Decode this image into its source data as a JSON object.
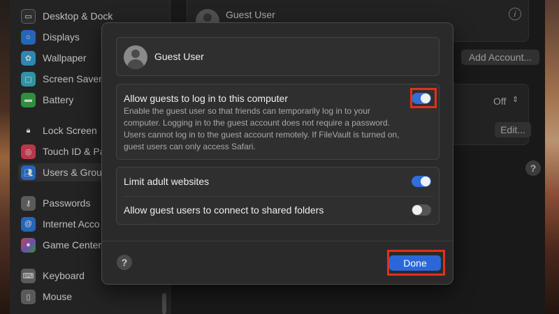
{
  "sidebar": {
    "items": [
      {
        "label": "Desktop & Dock",
        "icon": "desktop-dock-icon",
        "color": "#3a3a3c"
      },
      {
        "label": "Displays",
        "icon": "displays-icon",
        "color": "#2f7ce0"
      },
      {
        "label": "Wallpaper",
        "icon": "wallpaper-icon",
        "color": "#35a6d9"
      },
      {
        "label": "Screen Saver",
        "icon": "screen-saver-icon",
        "color": "#3bb4c8"
      },
      {
        "label": "Battery",
        "icon": "battery-icon",
        "color": "#3bae4a"
      },
      {
        "label": "Lock Screen",
        "icon": "lock-icon",
        "color": "#2b2b2c"
      },
      {
        "label": "Touch ID & Pa",
        "icon": "fingerprint-icon",
        "color": "#e2445c"
      },
      {
        "label": "Users & Grou",
        "icon": "users-icon",
        "color": "#2f7ce0"
      },
      {
        "label": "Passwords",
        "icon": "key-icon",
        "color": "#6e6e6e"
      },
      {
        "label": "Internet Acco",
        "icon": "at-icon",
        "color": "#2f7ce0"
      },
      {
        "label": "Game Center",
        "icon": "game-center-icon",
        "color": "#8a5fd6"
      },
      {
        "label": "Keyboard",
        "icon": "keyboard-icon",
        "color": "#6e6e6e"
      },
      {
        "label": "Mouse",
        "icon": "mouse-icon",
        "color": "#6e6e6e"
      }
    ],
    "selected_index": 7
  },
  "background": {
    "guest_user_label": "Guest User",
    "add_account_label": "Add Account...",
    "off_label": "Off",
    "edit_label": "Edit...",
    "help_label": "?",
    "info_label": "i"
  },
  "sheet": {
    "user_name": "Guest User",
    "allow_login": {
      "title": "Allow guests to log in to this computer",
      "description": "Enable the guest user so that friends can temporarily log in to your computer. Logging in to the guest account does not require a password. Users cannot log in to the guest account remotely. If FileVault is turned on, guest users can only access Safari.",
      "enabled": true
    },
    "limit_adult": {
      "title": "Limit adult websites",
      "enabled": true
    },
    "shared_folders": {
      "title": "Allow guest users to connect to shared folders",
      "enabled": false
    },
    "help_label": "?",
    "done_label": "Done"
  },
  "colors": {
    "accent": "#2c67d8",
    "highlight": "#e0321c"
  }
}
